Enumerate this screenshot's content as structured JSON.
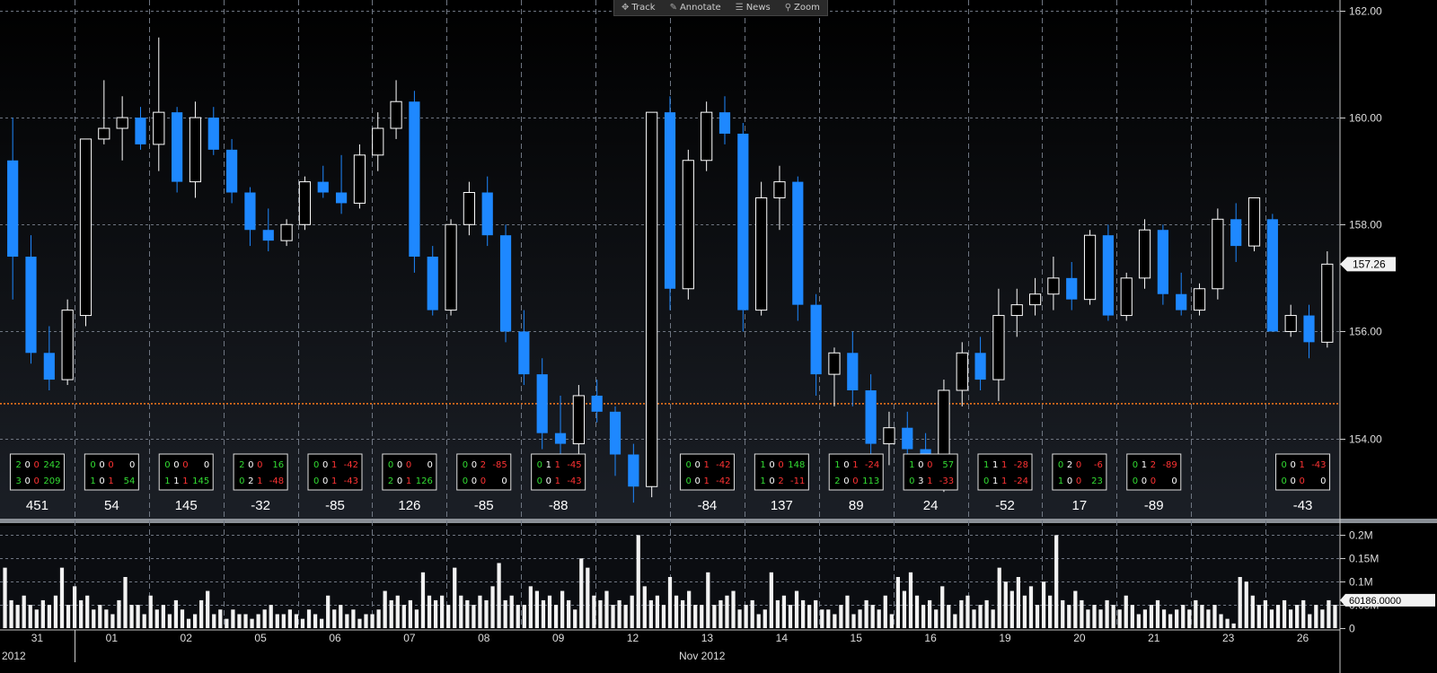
{
  "toolbar": [
    {
      "label": "Track",
      "icon": "crosshair-icon",
      "glyph": "✥"
    },
    {
      "label": "Annotate",
      "icon": "pencil-icon",
      "glyph": "✎"
    },
    {
      "label": "News",
      "icon": "news-icon",
      "glyph": "☰"
    },
    {
      "label": "Zoom",
      "icon": "magnifier-icon",
      "glyph": "⚲"
    }
  ],
  "colors": {
    "up": "#ffffff",
    "down": "#1e88ff",
    "grid": "#6f7682",
    "ref_line": "#ff7a1a",
    "pos": "#33dd33",
    "neg": "#ff3333"
  },
  "chart_data": [
    {
      "type": "candlestick",
      "ylim": [
        152.5,
        162.2
      ],
      "yticks": [
        "154.00",
        "156.00",
        "158.00",
        "160.00",
        "162.00"
      ],
      "reference_line": 154.65,
      "last_price": "157.26",
      "candles": [
        [
          159.2,
          160,
          156.6,
          157.4
        ],
        [
          157.4,
          157.8,
          155.4,
          155.6
        ],
        [
          155.6,
          156.1,
          154.9,
          155.1
        ],
        [
          155.1,
          156.6,
          155.0,
          156.4
        ],
        [
          156.3,
          159.5,
          156.1,
          159.6
        ],
        [
          159.6,
          160.7,
          159.5,
          159.8
        ],
        [
          159.8,
          160.4,
          159.2,
          160.0
        ],
        [
          160.0,
          160.2,
          159.4,
          159.5
        ],
        [
          159.5,
          161.5,
          159.0,
          160.1
        ],
        [
          160.1,
          160.2,
          158.6,
          158.8
        ],
        [
          158.8,
          160.3,
          158.5,
          160.0
        ],
        [
          160.0,
          160.2,
          159.3,
          159.4
        ],
        [
          159.4,
          159.6,
          158.4,
          158.6
        ],
        [
          158.6,
          158.7,
          157.6,
          157.9
        ],
        [
          157.9,
          158.3,
          157.5,
          157.7
        ],
        [
          157.7,
          158.1,
          157.6,
          158.0
        ],
        [
          158.0,
          158.9,
          157.9,
          158.8
        ],
        [
          158.8,
          159.1,
          158.5,
          158.6
        ],
        [
          158.6,
          159.3,
          158.2,
          158.4
        ],
        [
          158.4,
          159.5,
          158.3,
          159.3
        ],
        [
          159.3,
          160.1,
          159.0,
          159.8
        ],
        [
          159.8,
          160.7,
          159.6,
          160.3
        ],
        [
          160.3,
          160.5,
          157.1,
          157.4
        ],
        [
          157.4,
          157.6,
          156.3,
          156.4
        ],
        [
          156.4,
          158.1,
          156.3,
          158.0
        ],
        [
          158.0,
          158.8,
          157.8,
          158.6
        ],
        [
          158.6,
          158.9,
          157.6,
          157.8
        ],
        [
          157.8,
          158.0,
          155.8,
          156.0
        ],
        [
          156.0,
          156.4,
          155.0,
          155.2
        ],
        [
          155.2,
          155.5,
          153.8,
          154.1
        ],
        [
          154.1,
          154.8,
          153.4,
          153.9
        ],
        [
          153.9,
          155.0,
          153.6,
          154.8
        ],
        [
          154.8,
          155.1,
          154.3,
          154.5
        ],
        [
          154.5,
          154.6,
          153.3,
          153.7
        ],
        [
          153.7,
          153.9,
          152.8,
          153.1
        ],
        [
          153.1,
          160.1,
          152.9,
          160.1
        ],
        [
          160.1,
          160.4,
          156.4,
          156.8
        ],
        [
          156.8,
          159.4,
          156.6,
          159.2
        ],
        [
          159.2,
          160.3,
          159.0,
          160.1
        ],
        [
          160.1,
          160.4,
          159.5,
          159.7
        ],
        [
          159.7,
          159.9,
          156.0,
          156.4
        ],
        [
          156.4,
          158.8,
          156.3,
          158.5
        ],
        [
          158.5,
          159.1,
          157.9,
          158.8
        ],
        [
          158.8,
          158.9,
          156.2,
          156.5
        ],
        [
          156.5,
          156.7,
          154.8,
          155.2
        ],
        [
          155.2,
          155.7,
          154.6,
          155.6
        ],
        [
          155.6,
          156.0,
          154.6,
          154.9
        ],
        [
          154.9,
          155.2,
          153.7,
          153.9
        ],
        [
          153.9,
          154.5,
          153.5,
          154.2
        ],
        [
          154.2,
          154.5,
          153.6,
          153.8
        ],
        [
          153.8,
          154.1,
          153.1,
          153.2
        ],
        [
          153.2,
          155.1,
          153.0,
          154.9
        ],
        [
          154.9,
          155.8,
          154.6,
          155.6
        ],
        [
          155.6,
          155.9,
          154.9,
          155.1
        ],
        [
          155.1,
          156.8,
          154.7,
          156.3
        ],
        [
          156.3,
          156.8,
          155.9,
          156.5
        ],
        [
          156.5,
          157.0,
          156.3,
          156.7
        ],
        [
          156.7,
          157.4,
          156.4,
          157.0
        ],
        [
          157.0,
          157.3,
          156.4,
          156.6
        ],
        [
          156.6,
          157.9,
          156.5,
          157.8
        ],
        [
          157.8,
          158.0,
          156.2,
          156.3
        ],
        [
          156.3,
          157.1,
          156.2,
          157.0
        ],
        [
          157.0,
          158.1,
          156.8,
          157.9
        ],
        [
          157.9,
          158.0,
          156.5,
          156.7
        ],
        [
          156.7,
          157.1,
          156.3,
          156.4
        ],
        [
          156.4,
          156.9,
          156.3,
          156.8
        ],
        [
          156.8,
          158.3,
          156.6,
          158.1
        ],
        [
          158.1,
          158.4,
          157.3,
          157.6
        ],
        [
          157.6,
          158.5,
          157.5,
          158.5
        ],
        [
          158.1,
          158.2,
          156.0,
          156.0
        ],
        [
          156.0,
          156.5,
          155.9,
          156.3
        ],
        [
          156.3,
          156.5,
          155.5,
          155.8
        ],
        [
          155.8,
          157.5,
          155.7,
          157.26
        ]
      ],
      "columns": [
        {
          "label": "31",
          "signals": [
            [
              "2",
              "0",
              "0",
              "242"
            ],
            [
              "3",
              "0",
              "0",
              "209"
            ]
          ],
          "net": "451"
        },
        {
          "label": "01",
          "signals": [
            [
              "0",
              "0",
              "0",
              "0"
            ],
            [
              "1",
              "0",
              "1",
              "54"
            ]
          ],
          "net": "54"
        },
        {
          "label": "02",
          "signals": [
            [
              "0",
              "0",
              "0",
              "0"
            ],
            [
              "1",
              "1",
              "1",
              "145"
            ]
          ],
          "net": "145"
        },
        {
          "label": "05",
          "signals": [
            [
              "2",
              "0",
              "0",
              "16"
            ],
            [
              "0",
              "2",
              "1",
              "-48"
            ]
          ],
          "net": "-32"
        },
        {
          "label": "06",
          "signals": [
            [
              "0",
              "0",
              "1",
              "-42"
            ],
            [
              "0",
              "0",
              "1",
              "-43"
            ]
          ],
          "net": "-85"
        },
        {
          "label": "07",
          "signals": [
            [
              "0",
              "0",
              "0",
              "0"
            ],
            [
              "2",
              "0",
              "1",
              "126"
            ]
          ],
          "net": "126"
        },
        {
          "label": "08",
          "signals": [
            [
              "0",
              "0",
              "2",
              "-85"
            ],
            [
              "0",
              "0",
              "0",
              "0"
            ]
          ],
          "net": "-85"
        },
        {
          "label": "09",
          "signals": [
            [
              "0",
              "1",
              "1",
              "-45"
            ],
            [
              "0",
              "0",
              "1",
              "-43"
            ]
          ],
          "net": "-88"
        },
        {
          "label": "12",
          "signals": [],
          "net": ""
        },
        {
          "label": "13",
          "signals": [
            [
              "0",
              "0",
              "1",
              "-42"
            ],
            [
              "0",
              "0",
              "1",
              "-42"
            ]
          ],
          "net": "-84"
        },
        {
          "label": "14",
          "signals": [
            [
              "1",
              "0",
              "0",
              "148"
            ],
            [
              "1",
              "0",
              "2",
              "-11"
            ]
          ],
          "net": "137"
        },
        {
          "label": "15",
          "signals": [
            [
              "1",
              "0",
              "1",
              "-24"
            ],
            [
              "2",
              "0",
              "0",
              "113"
            ]
          ],
          "net": "89"
        },
        {
          "label": "16",
          "signals": [
            [
              "1",
              "0",
              "0",
              "57"
            ],
            [
              "0",
              "3",
              "1",
              "-33"
            ]
          ],
          "net": "24"
        },
        {
          "label": "19",
          "signals": [
            [
              "1",
              "1",
              "1",
              "-28"
            ],
            [
              "0",
              "1",
              "1",
              "-24"
            ]
          ],
          "net": "-52"
        },
        {
          "label": "20",
          "signals": [
            [
              "0",
              "2",
              "0",
              "-6"
            ],
            [
              "1",
              "0",
              "0",
              "23"
            ]
          ],
          "net": "17"
        },
        {
          "label": "21",
          "signals": [
            [
              "0",
              "1",
              "2",
              "-89"
            ],
            [
              "0",
              "0",
              "0",
              "0"
            ]
          ],
          "net": "-89"
        },
        {
          "label": "23",
          "signals": [],
          "net": ""
        },
        {
          "label": "26",
          "signals": [
            [
              "0",
              "0",
              "1",
              "-43"
            ],
            [
              "0",
              "0",
              "0",
              "0"
            ]
          ],
          "net": "-43"
        }
      ]
    },
    {
      "type": "bar",
      "ylim": [
        0,
        0.22
      ],
      "yticks": [
        "0",
        "0.05M",
        "0.1M",
        "0.15M",
        "0.2M"
      ],
      "last_value": "60186.0000",
      "values_m": [
        0.13,
        0.06,
        0.05,
        0.07,
        0.05,
        0.04,
        0.06,
        0.05,
        0.07,
        0.13,
        0.05,
        0.09,
        0.06,
        0.07,
        0.04,
        0.05,
        0.04,
        0.03,
        0.06,
        0.11,
        0.05,
        0.05,
        0.03,
        0.07,
        0.04,
        0.05,
        0.03,
        0.06,
        0.04,
        0.02,
        0.03,
        0.06,
        0.08,
        0.03,
        0.04,
        0.02,
        0.04,
        0.03,
        0.03,
        0.02,
        0.03,
        0.04,
        0.05,
        0.03,
        0.03,
        0.04,
        0.03,
        0.02,
        0.04,
        0.03,
        0.02,
        0.07,
        0.04,
        0.05,
        0.03,
        0.04,
        0.02,
        0.03,
        0.03,
        0.04,
        0.08,
        0.06,
        0.07,
        0.05,
        0.06,
        0.04,
        0.12,
        0.07,
        0.06,
        0.07,
        0.05,
        0.13,
        0.07,
        0.06,
        0.05,
        0.07,
        0.06,
        0.09,
        0.14,
        0.06,
        0.07,
        0.05,
        0.05,
        0.09,
        0.08,
        0.06,
        0.07,
        0.05,
        0.08,
        0.06,
        0.04,
        0.15,
        0.13,
        0.07,
        0.06,
        0.08,
        0.05,
        0.06,
        0.05,
        0.07,
        0.2,
        0.09,
        0.06,
        0.07,
        0.05,
        0.11,
        0.07,
        0.06,
        0.08,
        0.05,
        0.05,
        0.12,
        0.05,
        0.06,
        0.07,
        0.08,
        0.04,
        0.05,
        0.06,
        0.03,
        0.04,
        0.12,
        0.06,
        0.07,
        0.05,
        0.08,
        0.06,
        0.05,
        0.06,
        0.04,
        0.04,
        0.03,
        0.05,
        0.07,
        0.03,
        0.04,
        0.06,
        0.05,
        0.04,
        0.07,
        0.03,
        0.11,
        0.08,
        0.12,
        0.07,
        0.05,
        0.06,
        0.04,
        0.09,
        0.05,
        0.03,
        0.06,
        0.07,
        0.04,
        0.05,
        0.06,
        0.04,
        0.13,
        0.1,
        0.08,
        0.11,
        0.07,
        0.09,
        0.05,
        0.1,
        0.07,
        0.2,
        0.06,
        0.05,
        0.08,
        0.06,
        0.04,
        0.05,
        0.04,
        0.06,
        0.05,
        0.04,
        0.07,
        0.05,
        0.03,
        0.04,
        0.05,
        0.06,
        0.04,
        0.03,
        0.04,
        0.05,
        0.04,
        0.06,
        0.05,
        0.04,
        0.05,
        0.03,
        0.02,
        0.01,
        0.11,
        0.1,
        0.07,
        0.05,
        0.06,
        0.04,
        0.05,
        0.06,
        0.04,
        0.05,
        0.06,
        0.03,
        0.05,
        0.04,
        0.06,
        0.05
      ]
    }
  ],
  "x_axis": {
    "day_labels": [
      "31",
      "01",
      "02",
      "05",
      "06",
      "07",
      "08",
      "09",
      "12",
      "13",
      "14",
      "15",
      "16",
      "19",
      "20",
      "21",
      "23",
      "26"
    ],
    "month_labels": [
      {
        "label": "2012",
        "col": 0
      },
      {
        "label": "Nov 2012",
        "col": 9
      }
    ]
  }
}
